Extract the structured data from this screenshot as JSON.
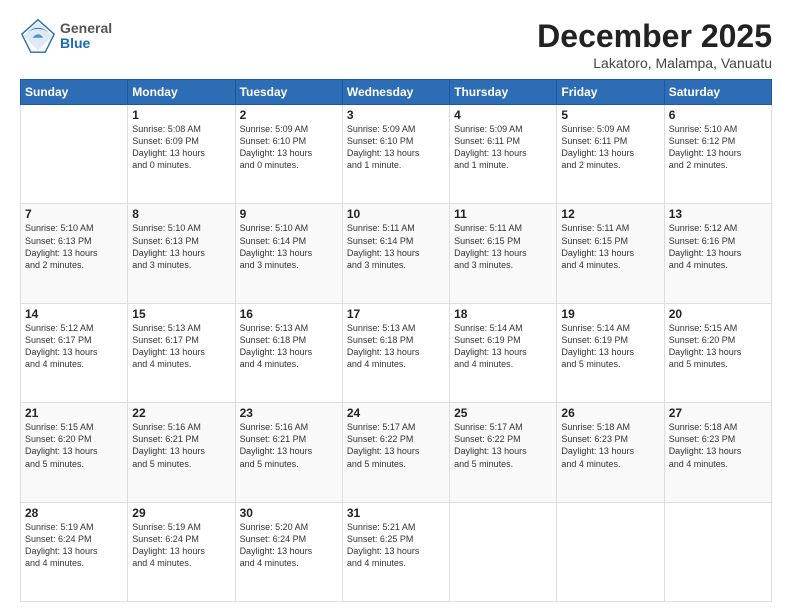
{
  "header": {
    "logo": {
      "general": "General",
      "blue": "Blue"
    },
    "title": "December 2025",
    "subtitle": "Lakatoro, Malampa, Vanuatu"
  },
  "calendar": {
    "days_of_week": [
      "Sunday",
      "Monday",
      "Tuesday",
      "Wednesday",
      "Thursday",
      "Friday",
      "Saturday"
    ],
    "weeks": [
      [
        {
          "day": "",
          "info": ""
        },
        {
          "day": "1",
          "info": "Sunrise: 5:08 AM\nSunset: 6:09 PM\nDaylight: 13 hours\nand 0 minutes."
        },
        {
          "day": "2",
          "info": "Sunrise: 5:09 AM\nSunset: 6:10 PM\nDaylight: 13 hours\nand 0 minutes."
        },
        {
          "day": "3",
          "info": "Sunrise: 5:09 AM\nSunset: 6:10 PM\nDaylight: 13 hours\nand 1 minute."
        },
        {
          "day": "4",
          "info": "Sunrise: 5:09 AM\nSunset: 6:11 PM\nDaylight: 13 hours\nand 1 minute."
        },
        {
          "day": "5",
          "info": "Sunrise: 5:09 AM\nSunset: 6:11 PM\nDaylight: 13 hours\nand 2 minutes."
        },
        {
          "day": "6",
          "info": "Sunrise: 5:10 AM\nSunset: 6:12 PM\nDaylight: 13 hours\nand 2 minutes."
        }
      ],
      [
        {
          "day": "7",
          "info": "Sunrise: 5:10 AM\nSunset: 6:13 PM\nDaylight: 13 hours\nand 2 minutes."
        },
        {
          "day": "8",
          "info": "Sunrise: 5:10 AM\nSunset: 6:13 PM\nDaylight: 13 hours\nand 3 minutes."
        },
        {
          "day": "9",
          "info": "Sunrise: 5:10 AM\nSunset: 6:14 PM\nDaylight: 13 hours\nand 3 minutes."
        },
        {
          "day": "10",
          "info": "Sunrise: 5:11 AM\nSunset: 6:14 PM\nDaylight: 13 hours\nand 3 minutes."
        },
        {
          "day": "11",
          "info": "Sunrise: 5:11 AM\nSunset: 6:15 PM\nDaylight: 13 hours\nand 3 minutes."
        },
        {
          "day": "12",
          "info": "Sunrise: 5:11 AM\nSunset: 6:15 PM\nDaylight: 13 hours\nand 4 minutes."
        },
        {
          "day": "13",
          "info": "Sunrise: 5:12 AM\nSunset: 6:16 PM\nDaylight: 13 hours\nand 4 minutes."
        }
      ],
      [
        {
          "day": "14",
          "info": "Sunrise: 5:12 AM\nSunset: 6:17 PM\nDaylight: 13 hours\nand 4 minutes."
        },
        {
          "day": "15",
          "info": "Sunrise: 5:13 AM\nSunset: 6:17 PM\nDaylight: 13 hours\nand 4 minutes."
        },
        {
          "day": "16",
          "info": "Sunrise: 5:13 AM\nSunset: 6:18 PM\nDaylight: 13 hours\nand 4 minutes."
        },
        {
          "day": "17",
          "info": "Sunrise: 5:13 AM\nSunset: 6:18 PM\nDaylight: 13 hours\nand 4 minutes."
        },
        {
          "day": "18",
          "info": "Sunrise: 5:14 AM\nSunset: 6:19 PM\nDaylight: 13 hours\nand 4 minutes."
        },
        {
          "day": "19",
          "info": "Sunrise: 5:14 AM\nSunset: 6:19 PM\nDaylight: 13 hours\nand 5 minutes."
        },
        {
          "day": "20",
          "info": "Sunrise: 5:15 AM\nSunset: 6:20 PM\nDaylight: 13 hours\nand 5 minutes."
        }
      ],
      [
        {
          "day": "21",
          "info": "Sunrise: 5:15 AM\nSunset: 6:20 PM\nDaylight: 13 hours\nand 5 minutes."
        },
        {
          "day": "22",
          "info": "Sunrise: 5:16 AM\nSunset: 6:21 PM\nDaylight: 13 hours\nand 5 minutes."
        },
        {
          "day": "23",
          "info": "Sunrise: 5:16 AM\nSunset: 6:21 PM\nDaylight: 13 hours\nand 5 minutes."
        },
        {
          "day": "24",
          "info": "Sunrise: 5:17 AM\nSunset: 6:22 PM\nDaylight: 13 hours\nand 5 minutes."
        },
        {
          "day": "25",
          "info": "Sunrise: 5:17 AM\nSunset: 6:22 PM\nDaylight: 13 hours\nand 5 minutes."
        },
        {
          "day": "26",
          "info": "Sunrise: 5:18 AM\nSunset: 6:23 PM\nDaylight: 13 hours\nand 4 minutes."
        },
        {
          "day": "27",
          "info": "Sunrise: 5:18 AM\nSunset: 6:23 PM\nDaylight: 13 hours\nand 4 minutes."
        }
      ],
      [
        {
          "day": "28",
          "info": "Sunrise: 5:19 AM\nSunset: 6:24 PM\nDaylight: 13 hours\nand 4 minutes."
        },
        {
          "day": "29",
          "info": "Sunrise: 5:19 AM\nSunset: 6:24 PM\nDaylight: 13 hours\nand 4 minutes."
        },
        {
          "day": "30",
          "info": "Sunrise: 5:20 AM\nSunset: 6:24 PM\nDaylight: 13 hours\nand 4 minutes."
        },
        {
          "day": "31",
          "info": "Sunrise: 5:21 AM\nSunset: 6:25 PM\nDaylight: 13 hours\nand 4 minutes."
        },
        {
          "day": "",
          "info": ""
        },
        {
          "day": "",
          "info": ""
        },
        {
          "day": "",
          "info": ""
        }
      ]
    ]
  }
}
